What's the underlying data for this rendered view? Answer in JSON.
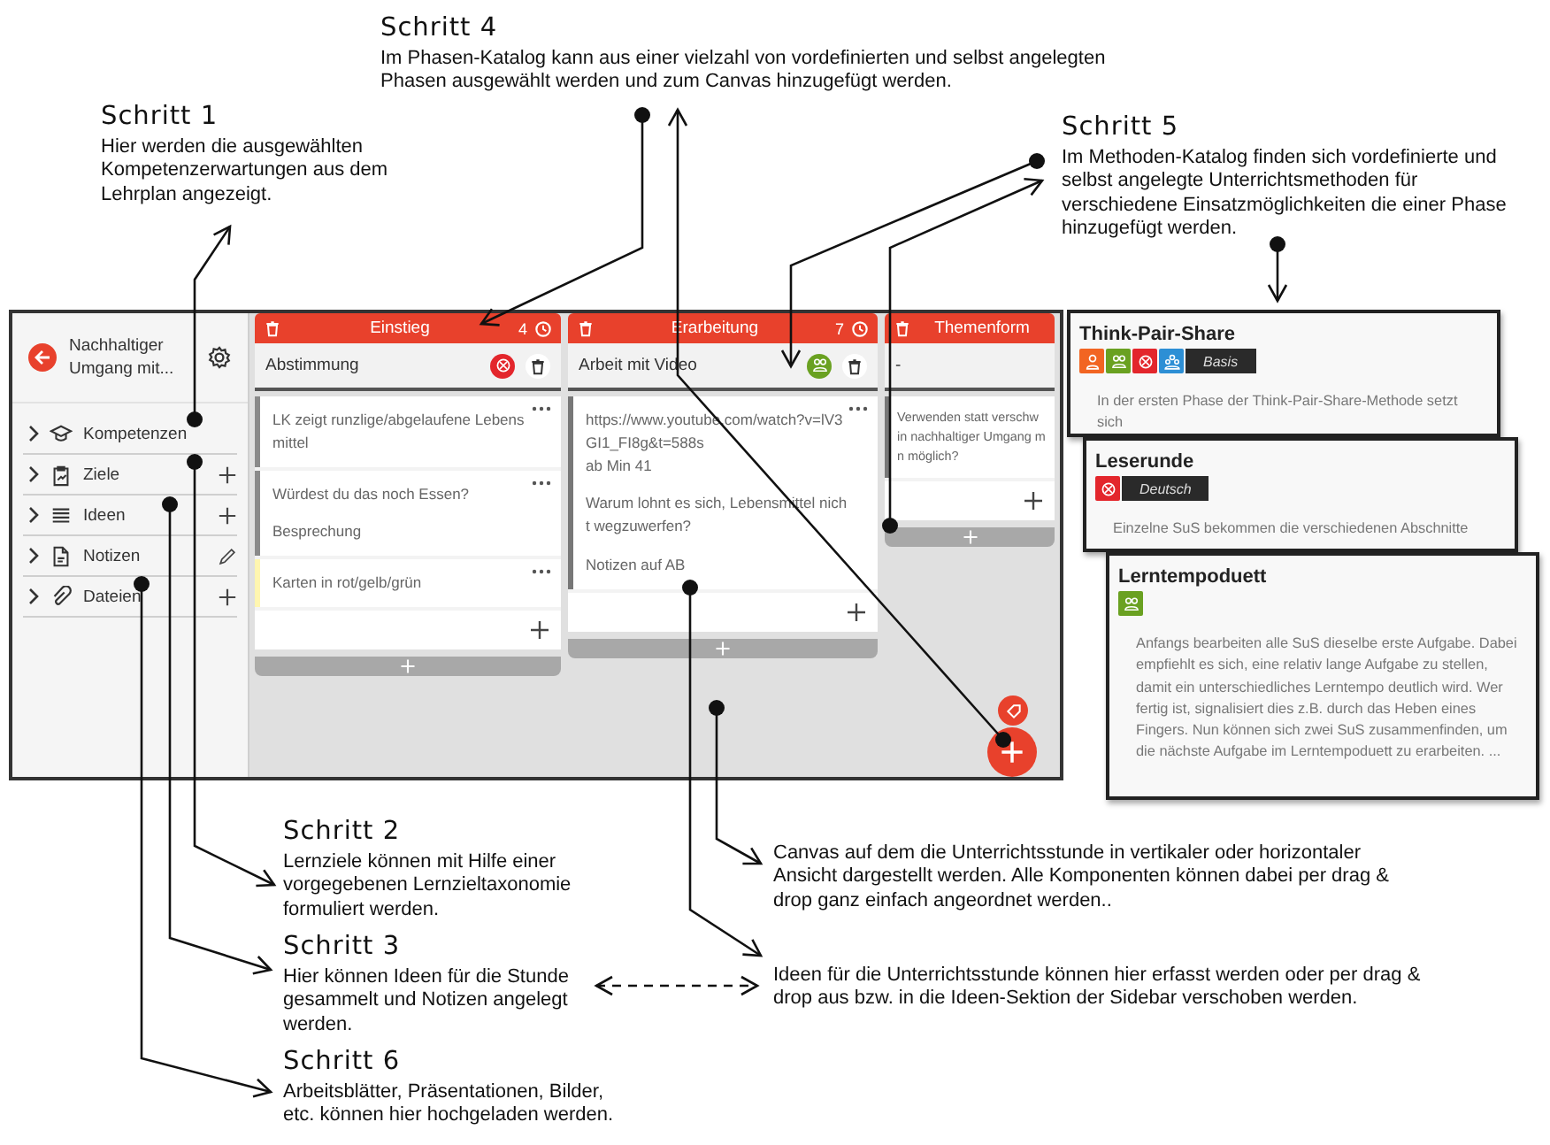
{
  "callouts_top": [
    {
      "heading": "Schritt 4",
      "text": "Im Phasen-Katalog kann aus einer vielzahl von vordefinierten und selbst angelegten Phasen ausgewählt werden und zum Canvas hinzugefügt werden."
    },
    {
      "heading": "Schritt 1",
      "text": "Hier werden die ausgewählten Kompetenzerwartungen aus dem Lehrplan angezeigt."
    },
    {
      "heading": "Schritt 5",
      "text": "Im Methoden-Katalog finden sich vordefinierte und selbst angelegte Unterrichtsmethoden für verschiedene Einsatzmöglichkeiten die einer Phase hinzugefügt werden."
    }
  ],
  "app": {
    "title": "Nachhaltiger Umgang mit...",
    "sidebar": [
      {
        "label": "Kompetenzen"
      },
      {
        "label": "Ziele",
        "can_add": true
      },
      {
        "label": "Ideen",
        "can_add": true
      },
      {
        "label": "Notizen",
        "can_edit": true
      },
      {
        "label": "Dateien",
        "can_add": true
      }
    ],
    "columns": [
      {
        "title": "Einstieg",
        "count": "4",
        "subtitle": "Abstimmung",
        "method": {
          "kind": "circle",
          "color": "#e3262c"
        },
        "cards": [
          {
            "color": "#8a8a8a",
            "paragraphs": [
              [
                "LK zeigt runzlige/abgelaufene Lebensmittel"
              ]
            ]
          },
          {
            "color": "#8a8a8a",
            "paragraphs": [
              [
                "Würdest du das noch Essen?"
              ],
              [
                "Besprechung"
              ]
            ]
          },
          {
            "color": "#fff6b0",
            "paragraphs": [
              [
                "Karten in rot/gelb/grün"
              ]
            ]
          }
        ]
      },
      {
        "title": "Erarbeitung",
        "count": "7",
        "subtitle": "Arbeit mit Video",
        "method": {
          "kind": "pair",
          "color": "#6aa121"
        },
        "cards": [
          {
            "color": "#777777",
            "paragraphs": [
              [
                "https://www.youtube.com/watch?v=lV3GI1_FI8g&t=588s",
                "ab Min 41"
              ],
              [
                "Warum lohnt es sich, Lebensmittel nicht wegzuwerfen?"
              ],
              [
                "Notizen auf AB"
              ]
            ]
          }
        ]
      },
      {
        "title": "Themenform",
        "subtitle": "-",
        "cards": [
          {
            "color": "#777777",
            "paragraphs": [
              [
                "Verwenden statt verschw",
                "in nachhaltiger Umgang m",
                "n möglich?"
              ]
            ]
          }
        ]
      }
    ]
  },
  "method_catalog": [
    {
      "title": "Think-Pair-Share",
      "tags": [
        {
          "kind": "single",
          "color": "#f26522"
        },
        {
          "kind": "pair",
          "color": "#6aa121"
        },
        {
          "kind": "circle",
          "color": "#e3262c"
        },
        {
          "kind": "group",
          "color": "#2d8fd5"
        },
        {
          "kind": "label",
          "text": "Basis"
        }
      ],
      "text": "In der ersten Phase der Think-Pair-Share-Methode setzt sich"
    },
    {
      "title": "Leserunde",
      "tags": [
        {
          "kind": "circle",
          "color": "#e3262c"
        },
        {
          "kind": "label",
          "text": "Deutsch"
        }
      ],
      "text": "Einzelne SuS bekommen die verschiedenen Abschnitte"
    },
    {
      "title": "Lerntempoduett",
      "tags": [
        {
          "kind": "pair",
          "color": "#6aa121"
        }
      ],
      "text": "Anfangs bearbeiten alle SuS dieselbe erste Aufgabe. Dabei empfiehlt es sich, eine relativ lange Aufgabe zu stellen, damit ein unterschiedliches Lerntempo deutlich wird. Wer fertig ist, signalisiert dies z.B. durch das Heben eines Fingers. Nun können sich zwei SuS zusammenfinden, um die nächste Aufgabe im Lerntempoduett zu erarbeiten. ..."
    }
  ],
  "callouts_bottom": [
    {
      "heading": "Schritt 2",
      "text": "Lernziele können mit Hilfe einer vorgegebenen Lernzieltaxonomie formuliert werden."
    },
    {
      "text": "Canvas auf dem die Unterrichtsstunde in vertikaler oder horizontaler Ansicht dargestellt werden. Alle Komponenten können dabei per drag & drop ganz einfach angeordnet werden.."
    },
    {
      "heading": "Schritt 3",
      "text": "Hier können Ideen für die Stunde gesammelt und Notizen angelegt werden."
    },
    {
      "text": "Ideen für die Unterrichtsstunde können hier erfasst werden oder per drag & drop aus bzw. in die Ideen-Sektion der Sidebar verschoben werden."
    },
    {
      "heading": "Schritt 6",
      "text": "Arbeitsblätter, Präsentationen, Bilder, etc. können hier hochgeladen werden."
    }
  ]
}
